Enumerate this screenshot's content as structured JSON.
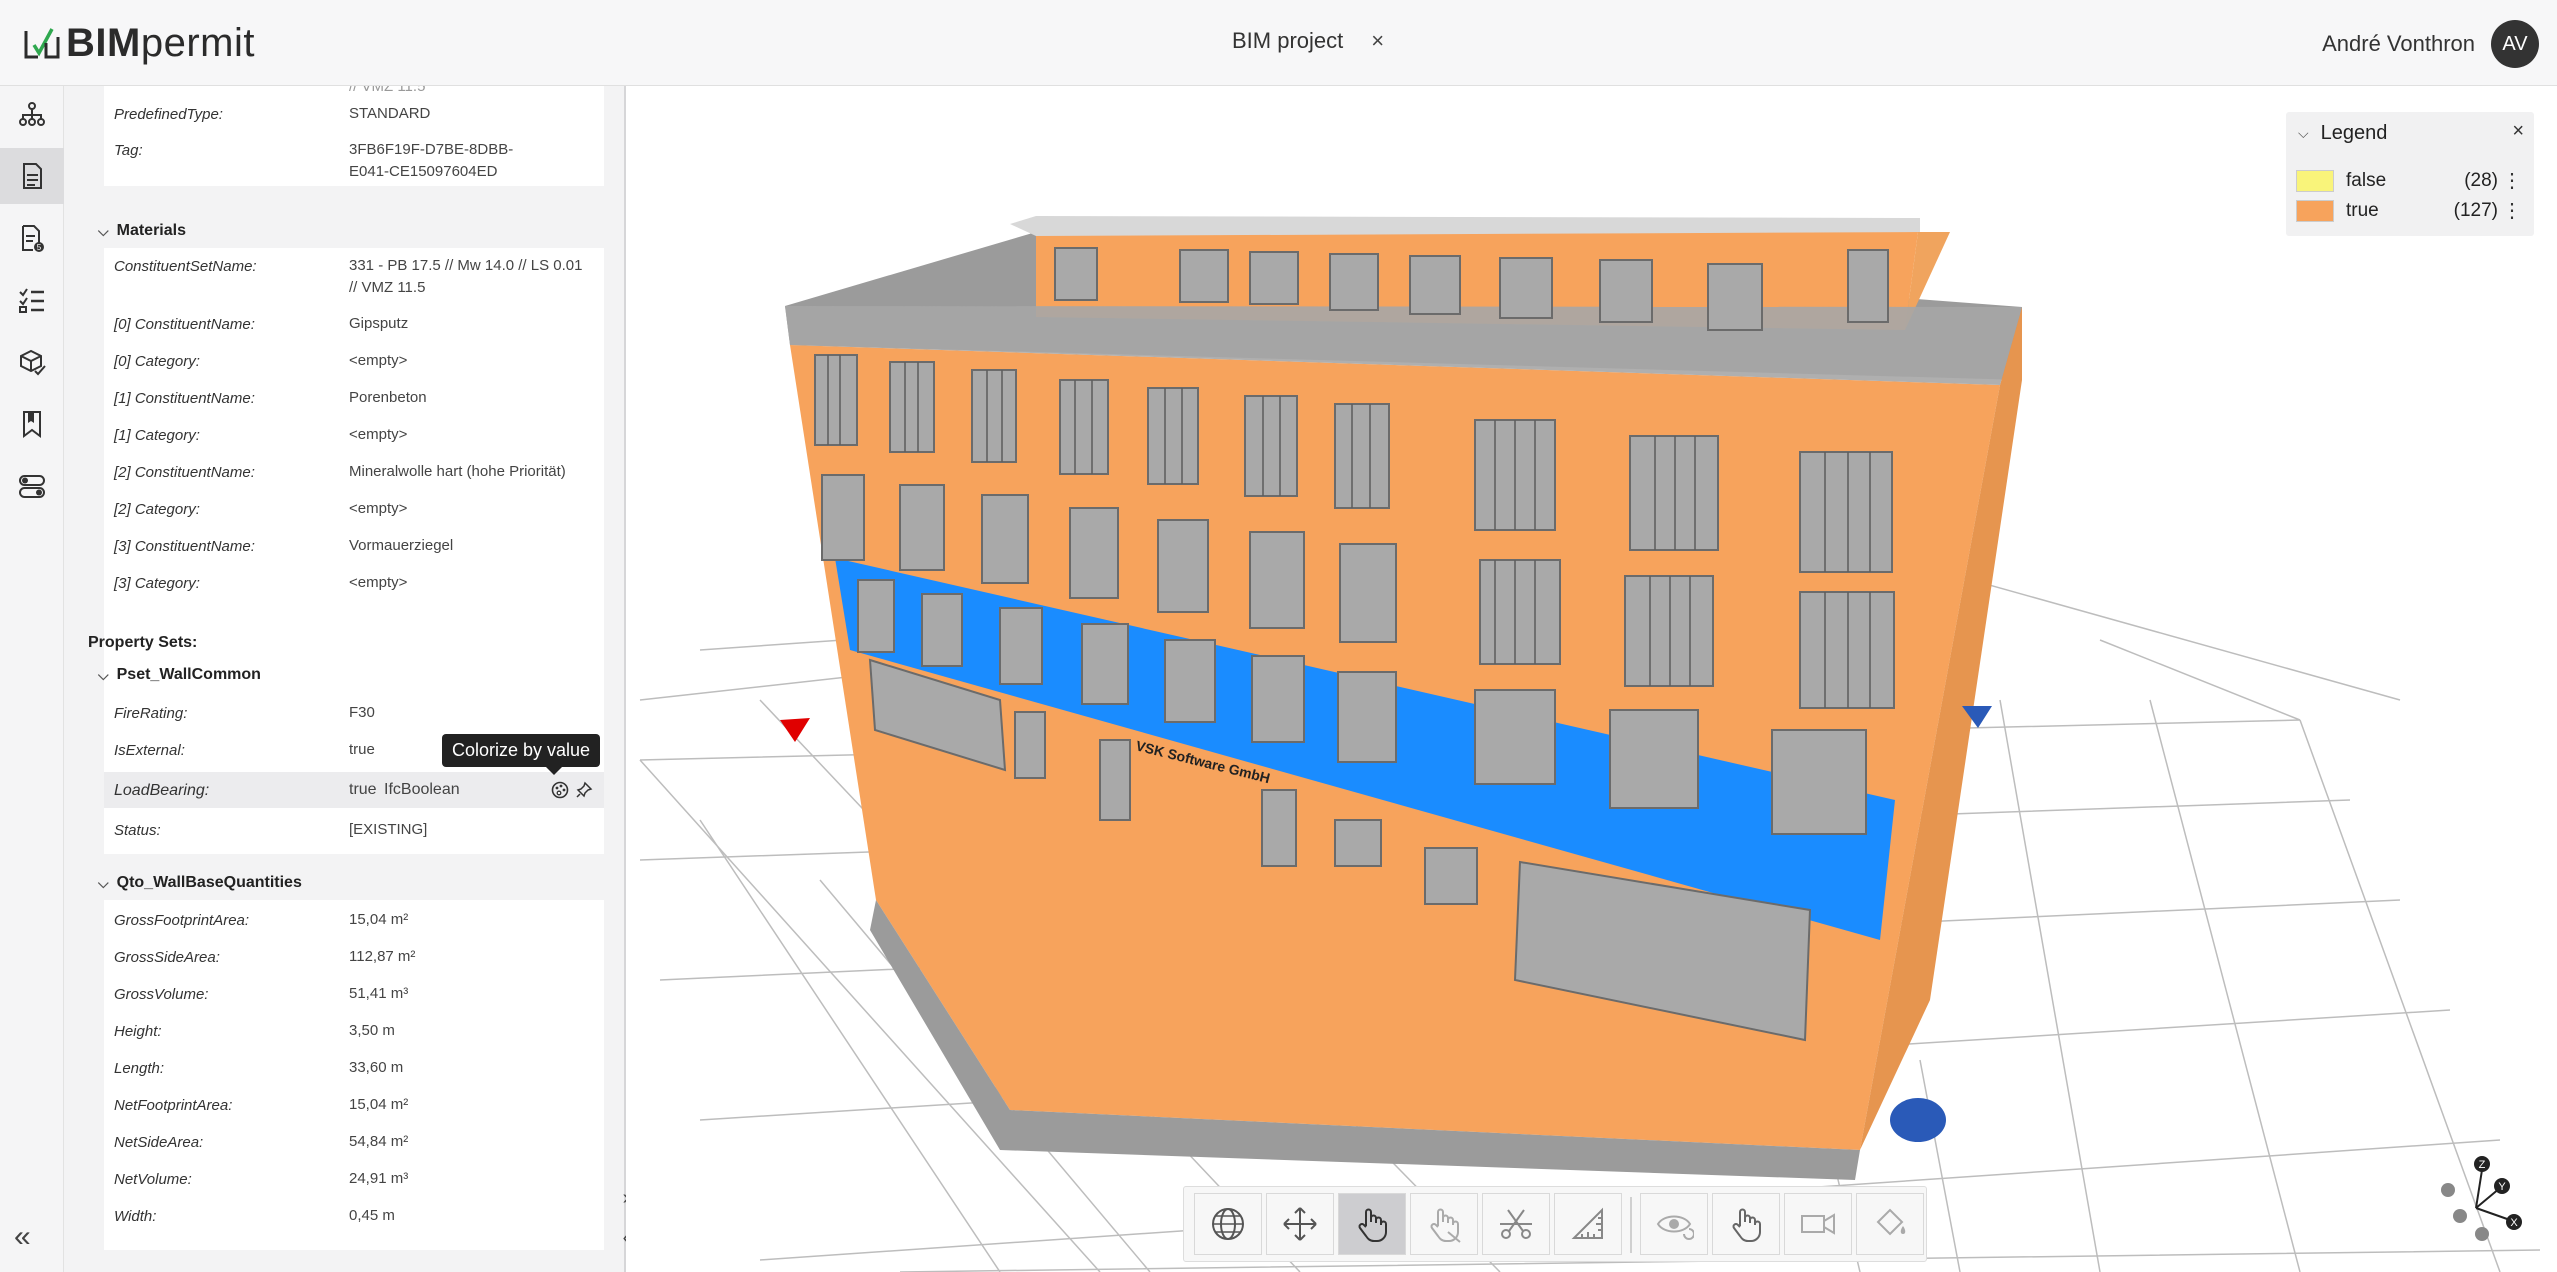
{
  "app": {
    "brand_bold": "BIM",
    "brand_rest": "permit"
  },
  "header": {
    "project_tab": "BIM project",
    "close_symbol": "×",
    "user_name": "André Vonthron",
    "user_initials": "AV"
  },
  "rail": {
    "icons": [
      "model-tree-icon",
      "properties-icon",
      "issues-icon",
      "checklist-icon",
      "model-check-icon",
      "bookmark-icon",
      "settings-toggle-icon"
    ],
    "collapse": "«"
  },
  "panel": {
    "top_rows": [
      {
        "key": "PredefinedType:",
        "value": "STANDARD"
      },
      {
        "key": "Tag:",
        "value": "3FB6F19F-D7BE-8DBB-E041-CE15097604ED"
      }
    ],
    "materials": {
      "title": "Materials",
      "rows": [
        {
          "key": "ConstituentSetName:",
          "value": "331 - PB 17.5 // Mw 14.0 // LS 0.01 // VMZ 11.5"
        },
        {
          "key": "[0] ConstituentName:",
          "value": "Gipsputz"
        },
        {
          "key": "[0] Category:",
          "value": "<empty>"
        },
        {
          "key": "[1] ConstituentName:",
          "value": "Porenbeton"
        },
        {
          "key": "[1] Category:",
          "value": "<empty>"
        },
        {
          "key": "[2] ConstituentName:",
          "value": "Mineralwolle hart (hohe Priorität)"
        },
        {
          "key": "[2] Category:",
          "value": "<empty>"
        },
        {
          "key": "[3] ConstituentName:",
          "value": "Vormauerziegel"
        },
        {
          "key": "[3] Category:",
          "value": "<empty>"
        }
      ]
    },
    "property_sets_title": "Property Sets:",
    "pset_wall": {
      "title": "Pset_WallCommon",
      "rows": [
        {
          "key": "FireRating:",
          "value": "F30"
        },
        {
          "key": "IsExternal:",
          "value": "true"
        },
        {
          "key": "LoadBearing:",
          "value": "true",
          "type": "IfcBoolean"
        },
        {
          "key": "Status:",
          "value": "[EXISTING]"
        }
      ],
      "tooltip": "Colorize by value"
    },
    "qto": {
      "title": "Qto_WallBaseQuantities",
      "rows": [
        {
          "key": "GrossFootprintArea:",
          "value": "15,04 m²"
        },
        {
          "key": "GrossSideArea:",
          "value": "112,87 m²"
        },
        {
          "key": "GrossVolume:",
          "value": "51,41 m³"
        },
        {
          "key": "Height:",
          "value": "3,50 m"
        },
        {
          "key": "Length:",
          "value": "33,60 m"
        },
        {
          "key": "NetFootprintArea:",
          "value": "15,04 m²"
        },
        {
          "key": "NetSideArea:",
          "value": "54,84 m²"
        },
        {
          "key": "NetVolume:",
          "value": "24,91 m³"
        },
        {
          "key": "Width:",
          "value": "0,45 m"
        }
      ]
    }
  },
  "viewer": {
    "sign_text": "VSK Software GmbH",
    "colors": {
      "true": "#f7a35c",
      "false": "#f8f56b",
      "band": "#1a8cff",
      "roof": "#9a9a9a"
    }
  },
  "legend": {
    "title": "Legend",
    "close": "×",
    "items": [
      {
        "label": "false",
        "count": "(28)",
        "color": "#f9f47a"
      },
      {
        "label": "true",
        "count": "(127)",
        "color": "#f7a35c"
      }
    ]
  },
  "toolbar": {
    "buttons": [
      "globe-icon",
      "move-icon",
      "select-hand-icon",
      "hide-hand-icon",
      "section-cut-icon",
      "measure-icon",
      "eye-refresh-icon",
      "hand-refresh-icon",
      "camera-refresh-icon",
      "paint-refresh-icon"
    ]
  },
  "gizmo": {
    "z": "Z",
    "y": "Y",
    "x": "X"
  }
}
